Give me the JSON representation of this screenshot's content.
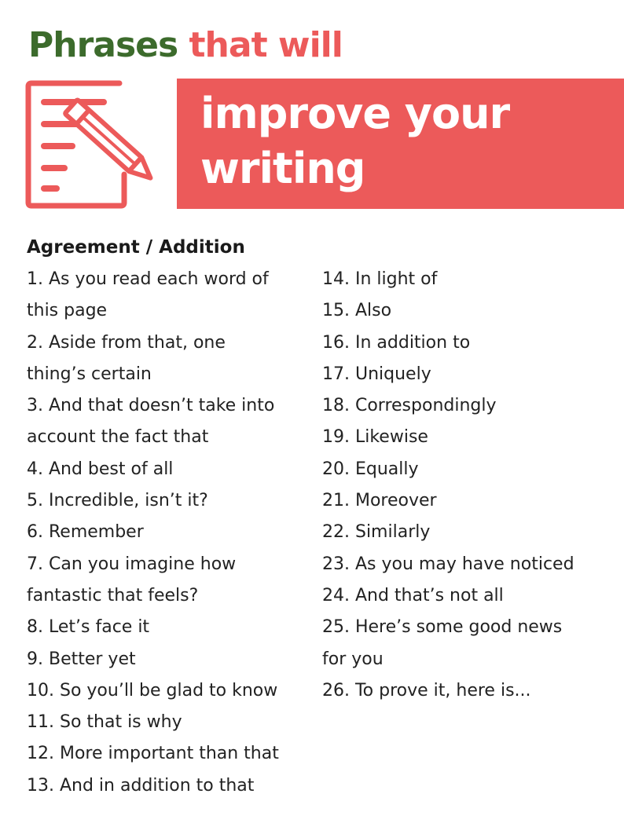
{
  "header": {
    "line1_word_green": "Phrases",
    "line1_word_red": "that will",
    "banner_line1": "improve your",
    "banner_line2": "writing",
    "accent_green": "#3c6b2c",
    "accent_red": "#ec5a5a",
    "icon": "document-pencil-icon"
  },
  "section": {
    "heading": "Agreement / Addition"
  },
  "left_column": [
    "1. As you read each word of",
    "this page",
    "2. Aside from that, one",
    "thing’s certain",
    "3. And that doesn’t take into",
    "account the fact that",
    "4. And best of all",
    "5. Incredible, isn’t it?",
    "6. Remember",
    "7. Can you imagine how",
    "fantastic that feels?",
    "8. Let’s face it",
    "9. Better yet",
    "10. So you’ll be glad to know",
    "11. So that is why",
    "12. More important than that",
    "13. And in addition to that"
  ],
  "right_column": [
    "14. In light of",
    "15. Also",
    "16. In addition to",
    "17. Uniquely",
    "18. Correspondingly",
    "19. Likewise",
    "20. Equally",
    "21. Moreover",
    "22. Similarly",
    "23. As you may have noticed",
    "24. And that’s not all",
    "25. Here’s some good news",
    "for you",
    "26. To prove it, here is..."
  ]
}
